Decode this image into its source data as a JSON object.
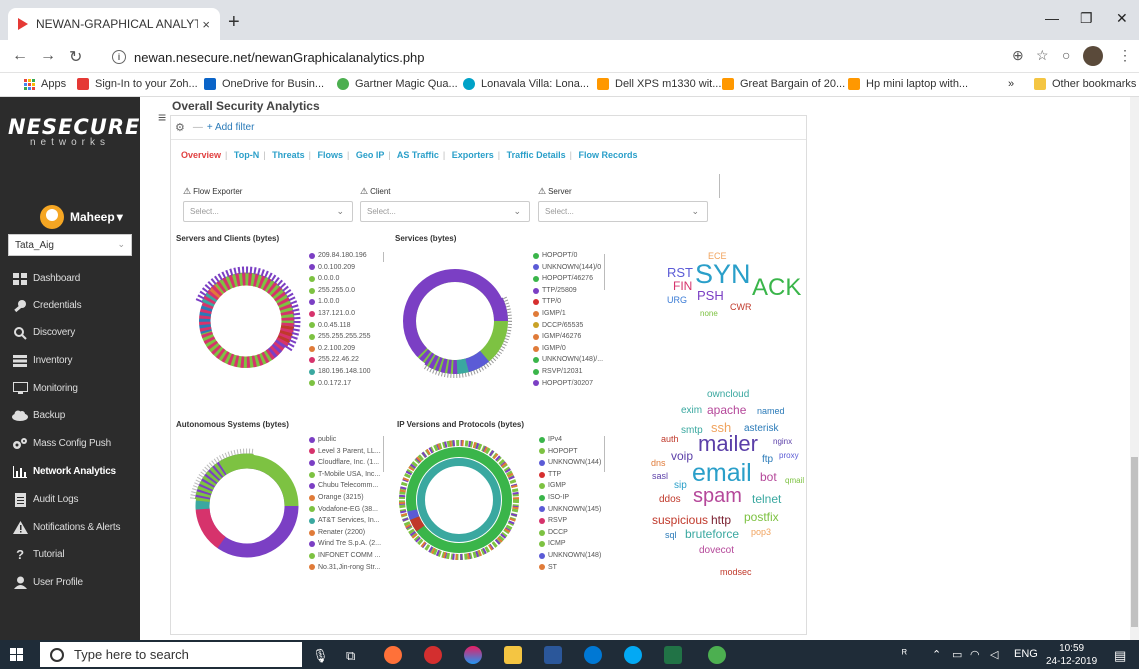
{
  "browser": {
    "tab_title": "NEWAN-GRAPHICAL ANALYTICS",
    "tab_close": "×",
    "new_tab": "+",
    "url": "newan.nesecure.net/newanGraphicalanalytics.php",
    "info_icon": "i",
    "bookmarks": [
      {
        "label": "Apps",
        "color": "#e8453c"
      },
      {
        "label": "Sign-In to your Zoh...",
        "color": "#e53935"
      },
      {
        "label": "OneDrive for Busin...",
        "color": "#0a64c8"
      },
      {
        "label": "Gartner Magic Qua...",
        "color": "#4caf50"
      },
      {
        "label": "Lonavala Villa: Lona...",
        "color": "#00a2c7"
      },
      {
        "label": "Dell XPS m1330 wit...",
        "color": "#ff9800"
      },
      {
        "label": "Great Bargain of 20...",
        "color": "#ff9800"
      },
      {
        "label": "Hp mini laptop with...",
        "color": "#ff9800"
      }
    ],
    "more_bookmarks": "»",
    "other_bookmarks": "Other bookmarks"
  },
  "sidebar": {
    "brand": "NESECURE",
    "brand_sub": "networks",
    "user_name": "Maheep",
    "user_chevron": "▾",
    "tenant": "Tata_Aig",
    "items": [
      {
        "label": "Dashboard",
        "icon": "dashboard-icon"
      },
      {
        "label": "Credentials",
        "icon": "key-icon"
      },
      {
        "label": "Discovery",
        "icon": "search-icon"
      },
      {
        "label": "Inventory",
        "icon": "inventory-icon"
      },
      {
        "label": "Monitoring",
        "icon": "monitor-icon"
      },
      {
        "label": "Backup",
        "icon": "cloud-icon"
      },
      {
        "label": "Mass Config Push",
        "icon": "gears-icon"
      },
      {
        "label": "Network Analytics",
        "icon": "chart-icon"
      },
      {
        "label": "Audit Logs",
        "icon": "document-icon"
      },
      {
        "label": "Notifications & Alerts",
        "icon": "warning-icon"
      },
      {
        "label": "Tutorial",
        "icon": "question-icon"
      },
      {
        "label": "User Profile",
        "icon": "user-icon"
      }
    ]
  },
  "main": {
    "page_title": "Overall Security Analytics",
    "add_filter": "+ Add filter",
    "tabs": [
      "Overview",
      "Top-N",
      "Threats",
      "Flows",
      "Geo IP",
      "AS Traffic",
      "Exporters",
      "Traffic Details",
      "Flow Records"
    ],
    "filters": [
      {
        "label": "Flow Exporter",
        "placeholder": "Select..."
      },
      {
        "label": "Client",
        "placeholder": "Select..."
      },
      {
        "label": "Server",
        "placeholder": "Select..."
      }
    ],
    "sections": {
      "servers_clients": {
        "title": "Servers and Clients (bytes)",
        "legend": [
          {
            "label": "209.84.180.196",
            "color": "#7b3fc4"
          },
          {
            "label": "0.0.100.209",
            "color": "#7b3fc4"
          },
          {
            "label": "0.0.0.0",
            "color": "#7dc242"
          },
          {
            "label": "255.255.0.0",
            "color": "#7dc242"
          },
          {
            "label": "1.0.0.0",
            "color": "#7b3fc4"
          },
          {
            "label": "137.121.0.0",
            "color": "#d6336c"
          },
          {
            "label": "0.0.45.118",
            "color": "#7dc242"
          },
          {
            "label": "255.255.255.255",
            "color": "#7dc242"
          },
          {
            "label": "0.2.100.209",
            "color": "#e07b39"
          },
          {
            "label": "255.22.46.22",
            "color": "#d6336c"
          },
          {
            "label": "180.196.148.100",
            "color": "#3aa8a0"
          },
          {
            "label": "0.0.172.17",
            "color": "#7dc242"
          }
        ]
      },
      "services": {
        "title": "Services (bytes)",
        "legend": [
          {
            "label": "HOPOPT/0",
            "color": "#3ab54a"
          },
          {
            "label": "UNKNOWN(144)/0",
            "color": "#5b5bd6"
          },
          {
            "label": "HOPOPT/46276",
            "color": "#3ab54a"
          },
          {
            "label": "TTP/25809",
            "color": "#7b3fc4"
          },
          {
            "label": "TTP/0",
            "color": "#d62f2f"
          },
          {
            "label": "IGMP/1",
            "color": "#e07b39"
          },
          {
            "label": "DCCP/65535",
            "color": "#c9a227"
          },
          {
            "label": "IGMP/46276",
            "color": "#e07b39"
          },
          {
            "label": "IGMP/0",
            "color": "#e07b39"
          },
          {
            "label": "UNKNOWN(148)/...",
            "color": "#3ab54a"
          },
          {
            "label": "RSVP/12031",
            "color": "#3ab54a"
          },
          {
            "label": "HOPOPT/30207",
            "color": "#7b3fc4"
          }
        ]
      },
      "autonomous": {
        "title": "Autonomous Systems (bytes)",
        "legend": [
          {
            "label": "public",
            "color": "#7b3fc4"
          },
          {
            "label": "Level 3 Parent, LL...",
            "color": "#d6336c"
          },
          {
            "label": "Cloudflare, Inc. (1...",
            "color": "#7b3fc4"
          },
          {
            "label": "T-Mobile USA, Inc...",
            "color": "#7dc242"
          },
          {
            "label": "Chubu Telecomm...",
            "color": "#7b3fc4"
          },
          {
            "label": "Orange (3215)",
            "color": "#e07b39"
          },
          {
            "label": "Vodafone-EG (38...",
            "color": "#7dc242"
          },
          {
            "label": "AT&T Services, In...",
            "color": "#3aa8a0"
          },
          {
            "label": "Renater (2200)",
            "color": "#e07b39"
          },
          {
            "label": "Wind Tre S.p.A. (2...",
            "color": "#7b3fc4"
          },
          {
            "label": "INFONET COMM ...",
            "color": "#7dc242"
          },
          {
            "label": "No.31,Jin-rong Str...",
            "color": "#e07b39"
          }
        ]
      },
      "ipversions": {
        "title": "IP Versions and Protocols (bytes)",
        "legend": [
          {
            "label": "IPv4",
            "color": "#3ab54a"
          },
          {
            "label": "HOPOPT",
            "color": "#7dc242"
          },
          {
            "label": "UNKNOWN(144)",
            "color": "#5b5bd6"
          },
          {
            "label": "TTP",
            "color": "#d62f2f"
          },
          {
            "label": "IGMP",
            "color": "#7dc242"
          },
          {
            "label": "ISO-IP",
            "color": "#3ab54a"
          },
          {
            "label": "UNKNOWN(145)",
            "color": "#5b5bd6"
          },
          {
            "label": "RSVP",
            "color": "#d6336c"
          },
          {
            "label": "DCCP",
            "color": "#7dc242"
          },
          {
            "label": "ICMP",
            "color": "#7dc242"
          },
          {
            "label": "UNKNOWN(148)",
            "color": "#5b5bd6"
          },
          {
            "label": "ST",
            "color": "#e07b39"
          }
        ]
      }
    },
    "tcp_flags": [
      {
        "text": "ECE",
        "color": "#f0a35e"
      },
      {
        "text": "RST",
        "color": "#5b5bd6"
      },
      {
        "text": "SYN",
        "color": "#2a9fc9"
      },
      {
        "text": "ACK",
        "color": "#3ab54a"
      },
      {
        "text": "FIN",
        "color": "#d6336c"
      },
      {
        "text": "PSH",
        "color": "#7b3fc4"
      },
      {
        "text": "URG",
        "color": "#3a7bd5"
      },
      {
        "text": "CWR",
        "color": "#c0392b"
      },
      {
        "text": "none",
        "color": "#7dc242"
      }
    ],
    "tags": [
      {
        "text": "owncloud",
        "color": "#3aa8a0"
      },
      {
        "text": "exim",
        "color": "#3aa8a0"
      },
      {
        "text": "apache",
        "color": "#b5489a"
      },
      {
        "text": "named",
        "color": "#2a7ab8"
      },
      {
        "text": "smtp",
        "color": "#3aa8a0"
      },
      {
        "text": "ssh",
        "color": "#f0a35e"
      },
      {
        "text": "asterisk",
        "color": "#2a7ab8"
      },
      {
        "text": "auth",
        "color": "#c0392b"
      },
      {
        "text": "mailer",
        "color": "#5b3fa8"
      },
      {
        "text": "nginx",
        "color": "#5b3fa8"
      },
      {
        "text": "voip",
        "color": "#5b3fa8"
      },
      {
        "text": "ftp",
        "color": "#2a7ab8"
      },
      {
        "text": "proxy",
        "color": "#5b5bd6"
      },
      {
        "text": "dns",
        "color": "#e07b39"
      },
      {
        "text": "email",
        "color": "#2a9fc9"
      },
      {
        "text": "sasl",
        "color": "#5b3fa8"
      },
      {
        "text": "sip",
        "color": "#2a9fc9"
      },
      {
        "text": "bot",
        "color": "#b5489a"
      },
      {
        "text": "qmail",
        "color": "#7dc242"
      },
      {
        "text": "ddos",
        "color": "#c0392b"
      },
      {
        "text": "spam",
        "color": "#b5489a"
      },
      {
        "text": "telnet",
        "color": "#3aa8a0"
      },
      {
        "text": "suspicious",
        "color": "#c0392b"
      },
      {
        "text": "http",
        "color": "#7a2030"
      },
      {
        "text": "postfix",
        "color": "#7dc242"
      },
      {
        "text": "sql",
        "color": "#2a7ab8"
      },
      {
        "text": "bruteforce",
        "color": "#3aa8a0"
      },
      {
        "text": "pop3",
        "color": "#f0a35e"
      },
      {
        "text": "dovecot",
        "color": "#b5489a"
      },
      {
        "text": "modsec",
        "color": "#c0392b"
      }
    ]
  },
  "taskbar": {
    "search_placeholder": "Type here to search",
    "tray_lang": "ENG",
    "time": "10:59",
    "date": "24-12-2019"
  }
}
